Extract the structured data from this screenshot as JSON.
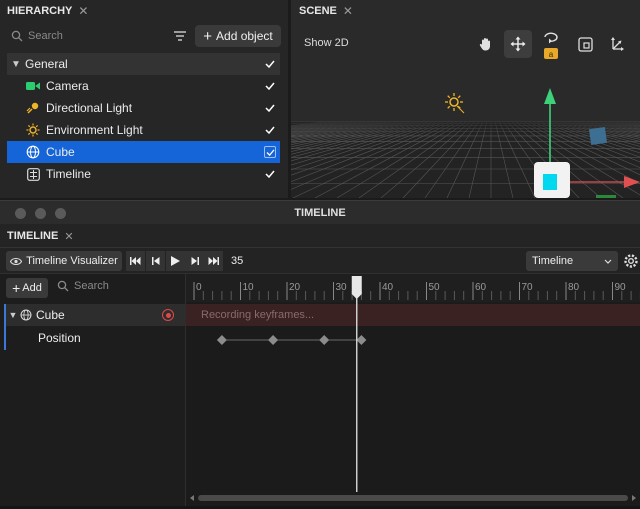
{
  "hierarchy": {
    "tab_title": "HIERARCHY",
    "close": "✕",
    "search_placeholder": "Search",
    "add_object_label": "Add object",
    "items": [
      {
        "label": "General",
        "icon": "chevron-down-icon"
      },
      {
        "label": "Camera",
        "icon": "camera-icon",
        "color": "#2ecc71"
      },
      {
        "label": "Directional Light",
        "icon": "directional-light-icon",
        "color": "#f0b429"
      },
      {
        "label": "Environment Light",
        "icon": "sun-icon",
        "color": "#f0b429"
      },
      {
        "label": "Cube",
        "icon": "globe-icon",
        "selected": true
      },
      {
        "label": "Timeline",
        "icon": "timeline-icon"
      }
    ]
  },
  "scene": {
    "tab_title": "SCENE",
    "close": "✕",
    "show_2d_label": "Show 2D",
    "tools": [
      "hand-icon",
      "move-icon",
      "rotate-icon",
      "scale-icon",
      "transform-icon"
    ],
    "accent": "#3dd17a"
  },
  "timeline_window": {
    "title": "TIMELINE"
  },
  "timeline": {
    "tab_title": "TIMELINE",
    "close": "✕",
    "visualizer_label": "Timeline Visualizer",
    "frame": "35",
    "select_value": "Timeline",
    "add_label": "Add",
    "search_placeholder": "Search",
    "tracks": [
      {
        "label": "Cube",
        "icon": "globe-icon"
      },
      {
        "label": "Position"
      }
    ],
    "recording_text": "Recording keyframes...",
    "ruler_labels": [
      "0",
      "10",
      "20",
      "30",
      "40",
      "50",
      "60",
      "70",
      "80",
      "90"
    ],
    "keyframes": [
      6,
      17,
      28,
      36
    ],
    "playhead": 35,
    "accent_record": "#e04848",
    "selection_color": "#1565d8"
  }
}
